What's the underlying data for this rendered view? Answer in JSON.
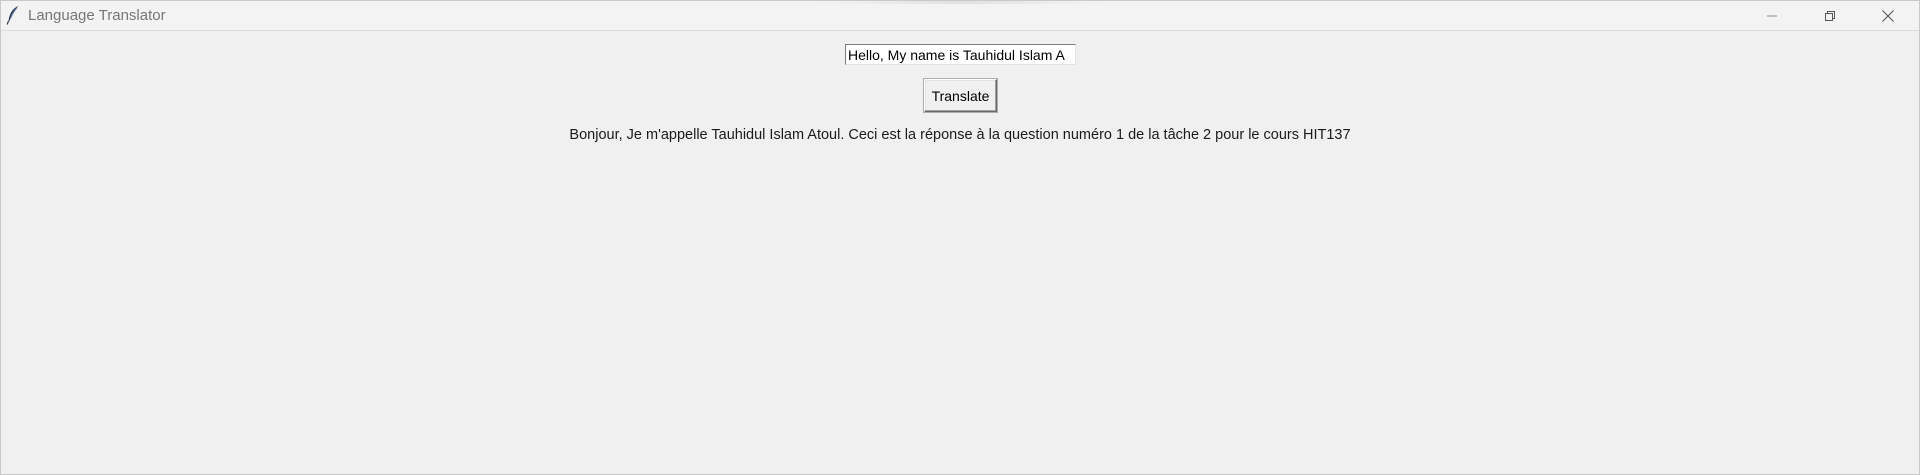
{
  "window": {
    "title": "Language Translator",
    "icon": "feather-icon",
    "controls": {
      "minimize_icon": "minimize-icon",
      "maximize_icon": "restore-icon",
      "close_icon": "close-icon"
    }
  },
  "form": {
    "input_value": "Hello, My name is Tauhidul Islam A",
    "translate_label": "Translate",
    "output_text": "Bonjour, Je m'appelle Tauhidul Islam Atoul. Ceci est la réponse à la question numéro 1 de la tâche 2 pour le cours HIT137"
  },
  "colors": {
    "background": "#f0f0f0",
    "titlebar": "#f3f3f3",
    "title_text": "#767676"
  }
}
